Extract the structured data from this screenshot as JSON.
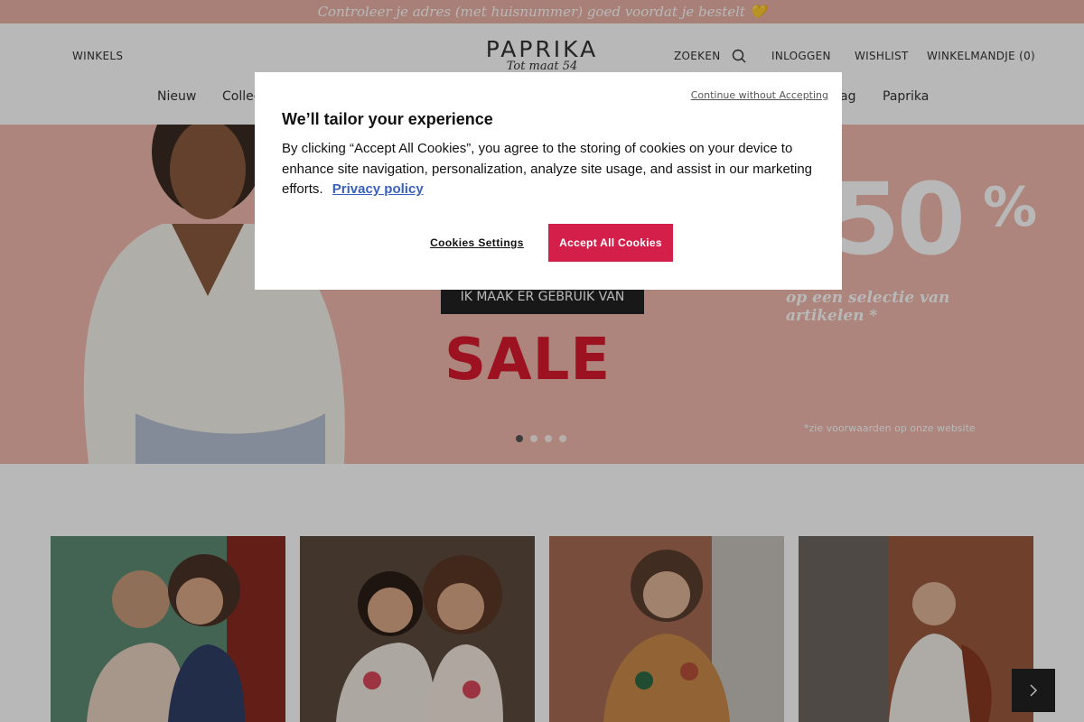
{
  "promo_bar": {
    "text": "Controleer je adres (met huisnummer) goed voordat je bestelt 💛"
  },
  "header": {
    "stores": "WINKELS",
    "logo_main": "PAPRIKA",
    "logo_sub": "Tot maat 54",
    "search": "ZOEKEN",
    "login": "INLOGGEN",
    "wishlist": "WISHLIST",
    "cart": "WINKELMANDJE (0)"
  },
  "nav": {
    "items": [
      {
        "label": "Nieuw"
      },
      {
        "label": "Collec"
      },
      {
        "label": "ag"
      },
      {
        "label": "Paprika"
      }
    ]
  },
  "hero": {
    "big_number": "50",
    "percent": "%",
    "subtitle": "op een selectie van artikelen *",
    "cta": "IK MAAK ER GEBRUIK VAN",
    "sale": "SALE",
    "terms": "*zie voorwaarden op onze website",
    "slides_total": 4,
    "active_slide": 1
  },
  "cookie_modal": {
    "continue_without": "Continue without Accepting",
    "title": "We’ll tailor your experience",
    "body": "By clicking “Accept All Cookies”, you agree to the storing of cookies on your device to enhance site navigation, personalization, analyze site usage, and assist in our marketing efforts.",
    "privacy_link": "Privacy policy",
    "settings_button": "Cookies Settings",
    "accept_button": "Accept All Cookies"
  },
  "colors": {
    "promo_bg": "#e9b2a5",
    "hero_bg": "#f0b9ac",
    "sale_red": "#d8192f",
    "accept_btn": "#d41f4a",
    "link_blue": "#3860be"
  },
  "icons": {
    "search": "search-icon",
    "carousel_next": "chevron-right-icon"
  }
}
